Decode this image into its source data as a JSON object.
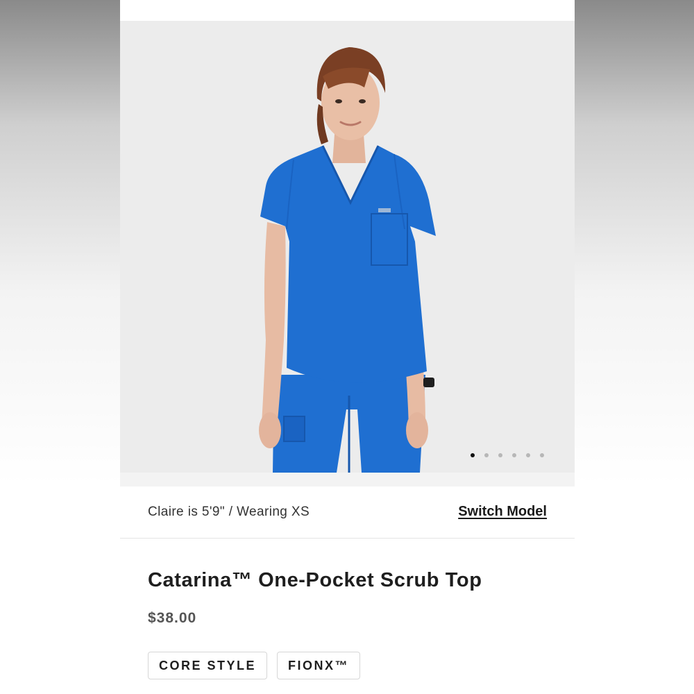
{
  "gallery": {
    "image_alt": "Model wearing royal blue scrub top",
    "dot_count": 6,
    "active_index": 0
  },
  "model_info": {
    "text": "Claire is 5'9\" / Wearing XS",
    "switch_label": "Switch Model"
  },
  "product": {
    "title": "Catarina™ One-Pocket Scrub Top",
    "price": "$38.00",
    "tags": [
      "CORE STYLE",
      "FIONX™"
    ]
  },
  "colors": {
    "scrub_blue": "#1f6fd1",
    "gallery_bg": "#ececec",
    "text_dark": "#1e1e1e"
  }
}
